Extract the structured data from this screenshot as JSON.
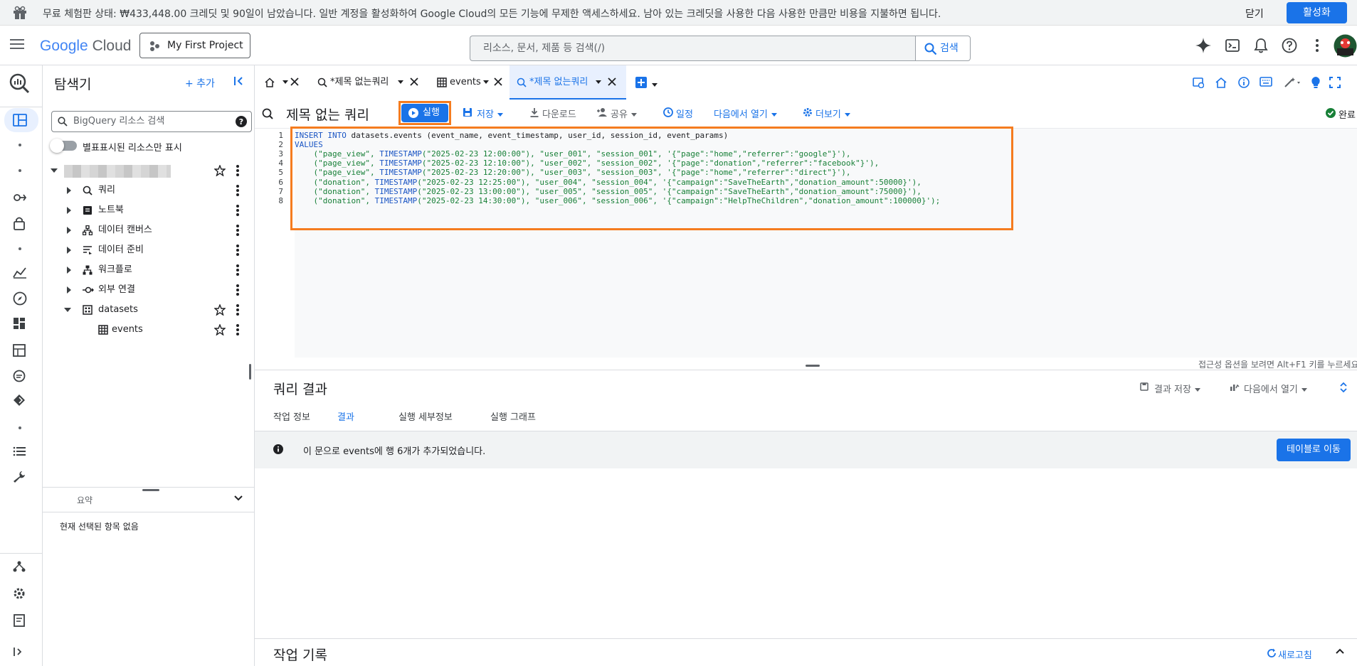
{
  "trial_banner": {
    "message": "무료 체험판 상태: ₩433,448.00 크레딧 및 90일이 남았습니다. 일반 계정을 활성화하여 Google Cloud의 모든 기능에 무제한 액세스하세요. 남아 있는 크레딧을 사용한 다음 사용한 만큼만 비용을 지불하면 됩니다.",
    "close_label": "닫기",
    "activate_label": "활성화"
  },
  "header": {
    "logo_google": "Google",
    "logo_cloud": "Cloud",
    "project_label": "My First Project",
    "search_placeholder": "리소스, 문서, 제품 등 검색(/)",
    "search_button": "검색"
  },
  "explorer": {
    "title": "탐색기",
    "add_label": "+ 추가",
    "search_placeholder": "BigQuery 리소스 검색",
    "starred_only_label": "별표표시된 리소스만 표시",
    "tree": [
      {
        "label": "쿼리",
        "icon": "query-icon"
      },
      {
        "label": "노트북",
        "icon": "notebook-icon"
      },
      {
        "label": "데이터 캔버스",
        "icon": "canvas-icon"
      },
      {
        "label": "데이터 준비",
        "icon": "data-prep-icon"
      },
      {
        "label": "워크플로",
        "icon": "workflow-icon"
      },
      {
        "label": "외부 연결",
        "icon": "connection-icon"
      },
      {
        "label": "datasets",
        "icon": "dataset-icon"
      },
      {
        "label": "events",
        "icon": "table-icon"
      }
    ],
    "summary_label": "요약",
    "summary_empty": "현재 선택된 항목 없음"
  },
  "tabs": [
    {
      "label": "*제목 없는쿼리",
      "icon": "query-icon",
      "active": false
    },
    {
      "label": "events",
      "icon": "table-icon",
      "active": false
    },
    {
      "label": "*제목 없는쿼리",
      "icon": "query-icon",
      "active": true
    }
  ],
  "query": {
    "title": "제목 없는 쿼리",
    "run_label": "실행",
    "save_label": "저장",
    "download_label": "다운로드",
    "share_label": "공유",
    "schedule_label": "일정",
    "open_in_label": "다음에서 열기",
    "more_label": "더보기",
    "status_label": "완료"
  },
  "editor": {
    "line_numbers": [
      "1",
      "2",
      "3",
      "4",
      "5",
      "6",
      "7",
      "8"
    ],
    "lines": [
      [
        "INSERT INTO",
        " datasets.events (event_name, event_timestamp, user_id, session_id, event_params)"
      ],
      [
        "VALUES",
        ""
      ],
      [
        "    (\"page_view\", ",
        "TIMESTAMP",
        "(\"2025-02-23 12:00:00\"), \"user_001\", \"session_001\", '{\"page\":\"home\",\"referrer\":\"google\"}'),"
      ],
      [
        "    (\"page_view\", ",
        "TIMESTAMP",
        "(\"2025-02-23 12:10:00\"), \"user_002\", \"session_002\", '{\"page\":\"donation\",\"referrer\":\"facebook\"}'),"
      ],
      [
        "    (\"page_view\", ",
        "TIMESTAMP",
        "(\"2025-02-23 12:20:00\"), \"user_003\", \"session_003\", '{\"page\":\"home\",\"referrer\":\"direct\"}'),"
      ],
      [
        "    (\"donation\", ",
        "TIMESTAMP",
        "(\"2025-02-23 12:25:00\"), \"user_004\", \"session_004\", '{\"campaign\":\"SaveTheEarth\",\"donation_amount\":50000}'),"
      ],
      [
        "    (\"donation\", ",
        "TIMESTAMP",
        "(\"2025-02-23 13:00:00\"), \"user_005\", \"session_005\", '{\"campaign\":\"SaveTheEarth\",\"donation_amount\":75000}'),"
      ],
      [
        "    (\"donation\", ",
        "TIMESTAMP",
        "(\"2025-02-23 14:30:00\"), \"user_006\", \"session_006\", '{\"campaign\":\"HelpTheChildren\",\"donation_amount\":100000}');"
      ]
    ],
    "a11y_hint": "접근성 옵션을 보려면 Alt+F1 키를 누르세요"
  },
  "results": {
    "title": "쿼리 결과",
    "save_results_label": "결과 저장",
    "open_in_label": "다음에서 열기",
    "tabs": [
      "작업 정보",
      "결과",
      "실행 세부정보",
      "실행 그래프"
    ],
    "active_tab": "결과",
    "message": "이 문으로 events에 행 6개가 추가되었습니다.",
    "goto_table_label": "테이블로 이동"
  },
  "history": {
    "title": "작업 기록",
    "refresh_label": "새로고침"
  },
  "colors": {
    "accent": "#1a73e8",
    "highlight_box": "#f57c1f",
    "keyword": "#1a55c4",
    "string": "#188038"
  }
}
